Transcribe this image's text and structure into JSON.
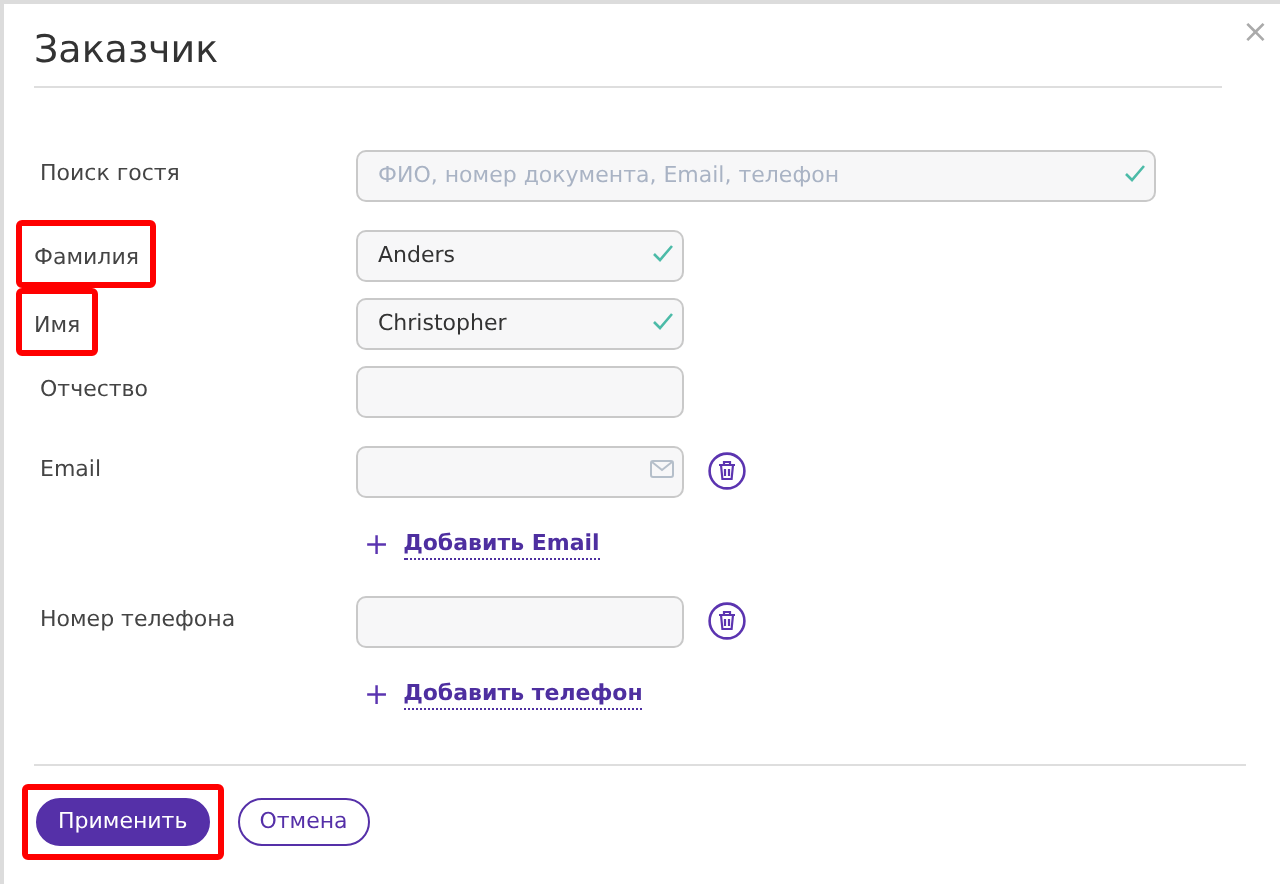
{
  "dialog": {
    "title": "Заказчик",
    "close": "×"
  },
  "rows": [
    {
      "kind": "field",
      "label": "Поиск гостя",
      "placeholder": "ФИО, номер документа, Email, телефон",
      "wide": true,
      "valid": true,
      "highlighted": false
    },
    {
      "kind": "field",
      "label": "Фамилия",
      "value": "Anders",
      "valid": true,
      "highlighted": true
    },
    {
      "kind": "field",
      "label": "Имя",
      "value": "Christopher",
      "valid": true,
      "highlighted": true
    },
    {
      "kind": "field",
      "label": "Отчество",
      "highlighted": false
    },
    {
      "kind": "email_field",
      "label": "Email",
      "removable": true,
      "highlighted": false
    },
    {
      "kind": "add_link",
      "plus": "+",
      "label": "Добавить Email"
    },
    {
      "kind": "field",
      "label": "Номер телефона",
      "removable": true,
      "highlighted": false
    },
    {
      "kind": "add_link",
      "plus": "+",
      "label": "Добавить телефон"
    }
  ],
  "buttons": [
    {
      "label": "Применить",
      "kind": "primary",
      "highlighted": true
    },
    {
      "label": "Отмена",
      "kind": "secondary",
      "highlighted": false
    }
  ]
}
